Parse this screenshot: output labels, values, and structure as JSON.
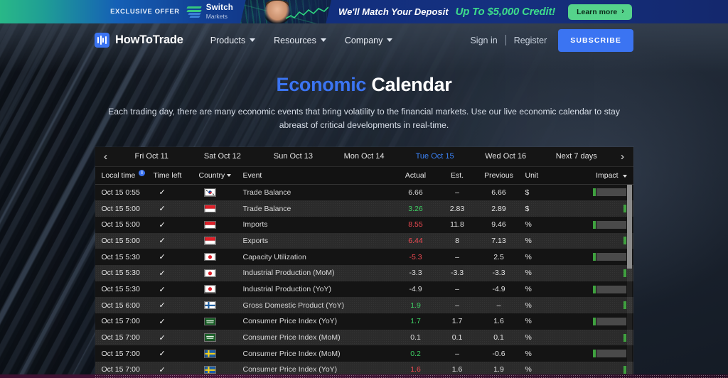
{
  "promo": {
    "exclusive_label": "EXCLUSIVE OFFER",
    "brand_top": "Switch",
    "brand_bottom": "Markets",
    "deposit_text": "We'll Match Your Deposit",
    "credit_text": "Up To $5,000 Credit!",
    "cta_label": "Learn more",
    "cta_chevron": "›"
  },
  "nav": {
    "brand": "HowToTrade",
    "links": [
      {
        "label": "Products"
      },
      {
        "label": "Resources"
      },
      {
        "label": "Company"
      }
    ],
    "sign_in": "Sign in",
    "register": "Register",
    "subscribe": "SUBSCRIBE"
  },
  "hero": {
    "title_blue": "Economic",
    "title_white": "Calendar",
    "subtitle": "Each trading day, there are many economic events that bring volatility to the financial markets. Use our live economic calendar to stay abreast of critical developments in real-time."
  },
  "calendar": {
    "prev_arrow": "‹",
    "next_arrow": "›",
    "dates": [
      {
        "label": "Fri Oct 11",
        "active": false
      },
      {
        "label": "Sat Oct 12",
        "active": false
      },
      {
        "label": "Sun Oct 13",
        "active": false
      },
      {
        "label": "Mon Oct 14",
        "active": false
      },
      {
        "label": "Tue Oct 15",
        "active": true
      },
      {
        "label": "Wed Oct 16",
        "active": false
      },
      {
        "label": "Next 7 days",
        "active": false
      }
    ],
    "columns": {
      "local_time": "Local time",
      "local_time_info": "i",
      "time_left": "Time left",
      "country": "Country",
      "event": "Event",
      "actual": "Actual",
      "est": "Est.",
      "previous": "Previous",
      "unit": "Unit",
      "impact": "Impact"
    },
    "rows": [
      {
        "time": "Oct 15 0:55",
        "check": "✓",
        "country": "kr",
        "event": "Trade Balance",
        "actual": "6.66",
        "actual_state": "flat",
        "est": "–",
        "previous": "6.66",
        "unit": "$",
        "impact_bars": 1,
        "impact_tip": true
      },
      {
        "time": "Oct 15 5:00",
        "check": "✓",
        "country": "id",
        "event": "Trade Balance",
        "actual": "3.26",
        "actual_state": "up",
        "est": "2.83",
        "previous": "2.89",
        "unit": "$",
        "impact_bars": 1,
        "impact_tip": false
      },
      {
        "time": "Oct 15 5:00",
        "check": "✓",
        "country": "id",
        "event": "Imports",
        "actual": "8.55",
        "actual_state": "down",
        "est": "11.8",
        "previous": "9.46",
        "unit": "%",
        "impact_bars": 1,
        "impact_tip": true
      },
      {
        "time": "Oct 15 5:00",
        "check": "✓",
        "country": "id",
        "event": "Exports",
        "actual": "6.44",
        "actual_state": "down",
        "est": "8",
        "previous": "7.13",
        "unit": "%",
        "impact_bars": 1,
        "impact_tip": false
      },
      {
        "time": "Oct 15 5:30",
        "check": "✓",
        "country": "jp",
        "event": "Capacity Utilization",
        "actual": "-5.3",
        "actual_state": "down",
        "est": "–",
        "previous": "2.5",
        "unit": "%",
        "impact_bars": 1,
        "impact_tip": true
      },
      {
        "time": "Oct 15 5:30",
        "check": "✓",
        "country": "jp",
        "event": "Industrial Production (MoM)",
        "actual": "-3.3",
        "actual_state": "flat",
        "est": "-3.3",
        "previous": "-3.3",
        "unit": "%",
        "impact_bars": 1,
        "impact_tip": false
      },
      {
        "time": "Oct 15 5:30",
        "check": "✓",
        "country": "jp",
        "event": "Industrial Production (YoY)",
        "actual": "-4.9",
        "actual_state": "flat",
        "est": "–",
        "previous": "-4.9",
        "unit": "%",
        "impact_bars": 1,
        "impact_tip": true
      },
      {
        "time": "Oct 15 6:00",
        "check": "✓",
        "country": "fi",
        "event": "Gross Domestic Product (YoY)",
        "actual": "1.9",
        "actual_state": "up",
        "est": "–",
        "previous": "–",
        "unit": "%",
        "impact_bars": 1,
        "impact_tip": false
      },
      {
        "time": "Oct 15 7:00",
        "check": "✓",
        "country": "sa",
        "event": "Consumer Price Index (YoY)",
        "actual": "1.7",
        "actual_state": "up",
        "est": "1.7",
        "previous": "1.6",
        "unit": "%",
        "impact_bars": 1,
        "impact_tip": true
      },
      {
        "time": "Oct 15 7:00",
        "check": "✓",
        "country": "sa",
        "event": "Consumer Price Index (MoM)",
        "actual": "0.1",
        "actual_state": "flat",
        "est": "0.1",
        "previous": "0.1",
        "unit": "%",
        "impact_bars": 1,
        "impact_tip": false
      },
      {
        "time": "Oct 15 7:00",
        "check": "✓",
        "country": "se",
        "event": "Consumer Price Index (MoM)",
        "actual": "0.2",
        "actual_state": "up",
        "est": "–",
        "previous": "-0.6",
        "unit": "%",
        "impact_bars": 1,
        "impact_tip": true
      },
      {
        "time": "Oct 15 7:00",
        "check": "✓",
        "country": "se",
        "event": "Consumer Price Index (YoY)",
        "actual": "1.6",
        "actual_state": "down",
        "est": "1.6",
        "previous": "1.9",
        "unit": "%",
        "impact_bars": 1,
        "impact_tip": false
      }
    ]
  },
  "colors": {
    "accent_blue": "#3b74f2",
    "value_up": "#3ecf63",
    "value_down": "#ef4a52",
    "impact_green": "#3fa13f",
    "promo_green": "#3ddc8c"
  }
}
